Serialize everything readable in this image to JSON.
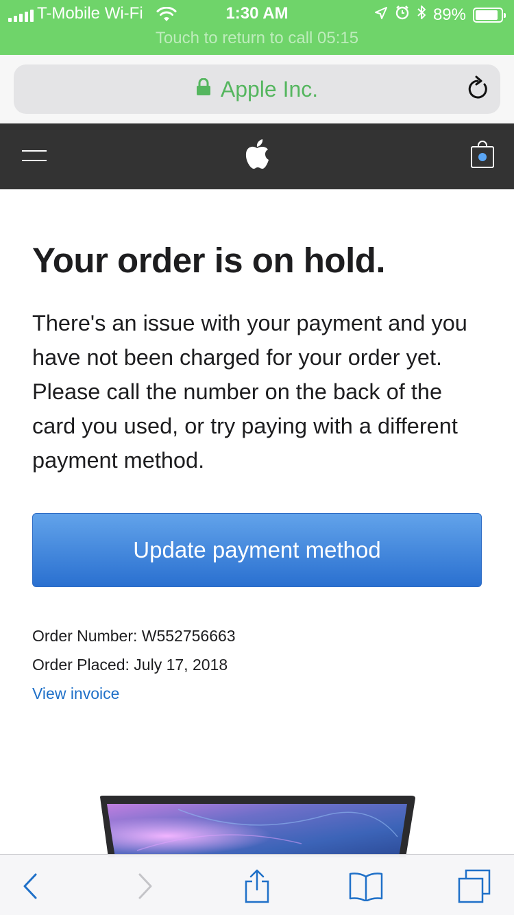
{
  "status_bar": {
    "carrier": "T-Mobile Wi-Fi",
    "time": "1:30 AM",
    "battery": "89%",
    "battery_level": 0.89,
    "call_banner": "Touch to return to call 05:15"
  },
  "address_bar": {
    "site_name": "Apple Inc.",
    "site_color": "#55b65f"
  },
  "global_nav": {
    "background": "#333333",
    "icons": [
      "menu-icon",
      "apple-logo",
      "shopping-bag-icon"
    ]
  },
  "content": {
    "headline": "Your order is on hold.",
    "message": "There's an issue with your payment and you have not been charged for your order yet. Please call the number on the back of the card you used, or try paying with a different payment method.",
    "cta_label": "Update payment method",
    "order_number": "Order Number: W552756663",
    "order_placed": "Order Placed: July 17, 2018",
    "invoice_link": "View invoice"
  },
  "toolbar": {
    "icons": [
      "back-icon",
      "forward-icon",
      "share-icon",
      "bookmarks-icon",
      "tabs-icon"
    ],
    "accent": "#1f70c8"
  }
}
